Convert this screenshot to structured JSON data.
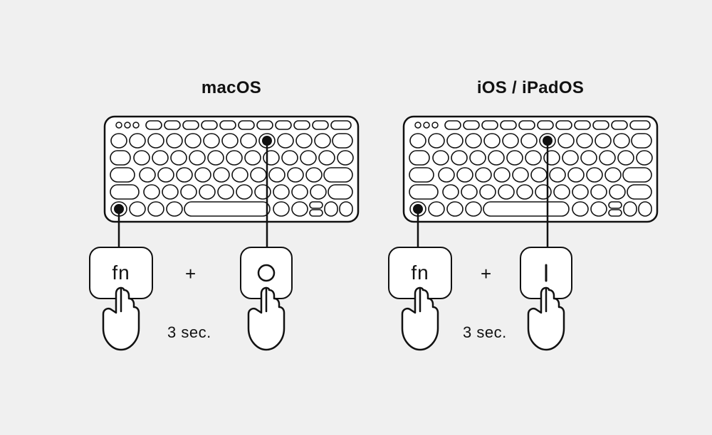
{
  "left": {
    "heading": "macOS",
    "key1": "fn",
    "plus": "+",
    "key2_glyph": "circle",
    "duration": "3 sec."
  },
  "right": {
    "heading": "iOS / iPadOS",
    "key1": "fn",
    "plus": "+",
    "key2_glyph": "bar",
    "duration": "3 sec."
  }
}
